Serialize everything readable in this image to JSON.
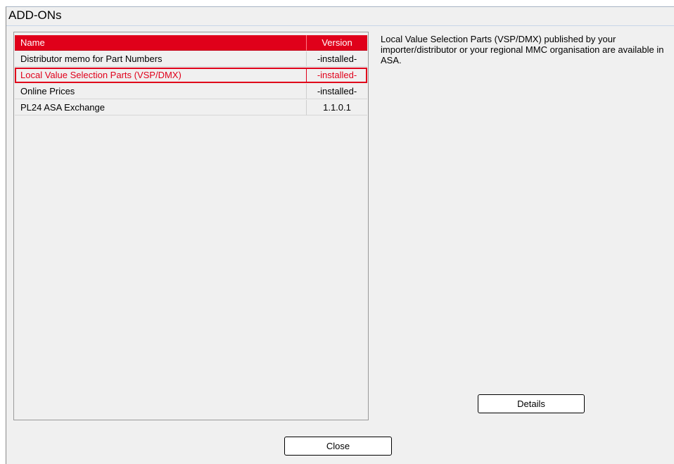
{
  "window": {
    "title": "ADD-ONs"
  },
  "addon_list": {
    "columns": {
      "name": "Name",
      "version": "Version"
    },
    "rows": [
      {
        "name": "Distributor memo for Part Numbers",
        "version": "-installed-",
        "selected": false
      },
      {
        "name": "Local Value Selection Parts (VSP/DMX)",
        "version": "-installed-",
        "selected": true
      },
      {
        "name": "Online Prices",
        "version": "-installed-",
        "selected": false
      },
      {
        "name": "PL24 ASA Exchange",
        "version": "1.1.0.1",
        "selected": false
      }
    ]
  },
  "description": {
    "text": "Local Value Selection Parts (VSP/DMX) published by your importer/distributor or your regional MMC organisation are available in ASA."
  },
  "buttons": {
    "details_label": "Details",
    "close_label": "Close"
  },
  "colors": {
    "accent": "#e0001a",
    "window_bg": "#f0f0f0"
  }
}
